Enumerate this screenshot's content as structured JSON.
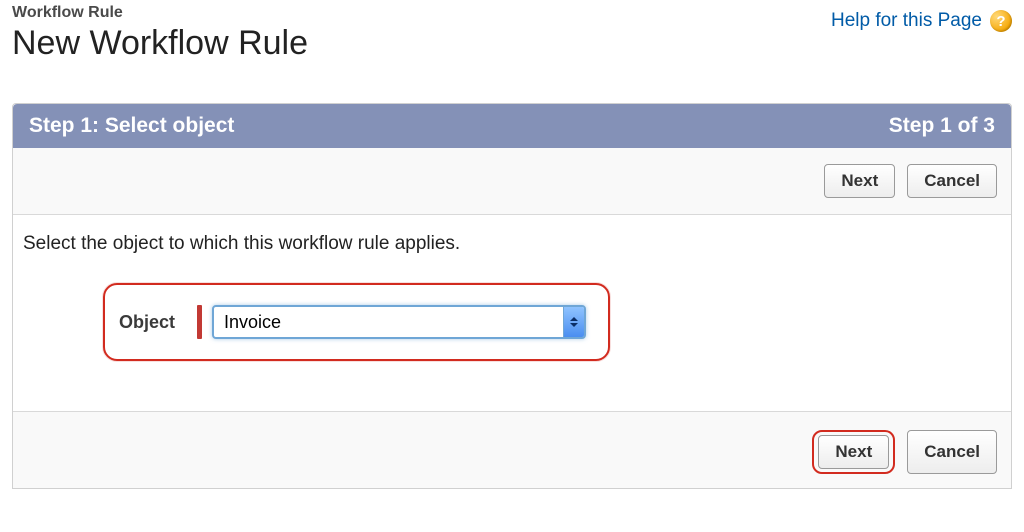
{
  "header": {
    "eyebrow": "Workflow Rule",
    "title": "New Workflow Rule",
    "help_link": "Help for this Page",
    "help_glyph": "?"
  },
  "step_bar": {
    "left": "Step 1: Select object",
    "right": "Step 1 of 3"
  },
  "instruction": "Select the object to which this workflow rule applies.",
  "object_field": {
    "label": "Object",
    "selected": "Invoice"
  },
  "buttons": {
    "next": "Next",
    "cancel": "Cancel"
  }
}
